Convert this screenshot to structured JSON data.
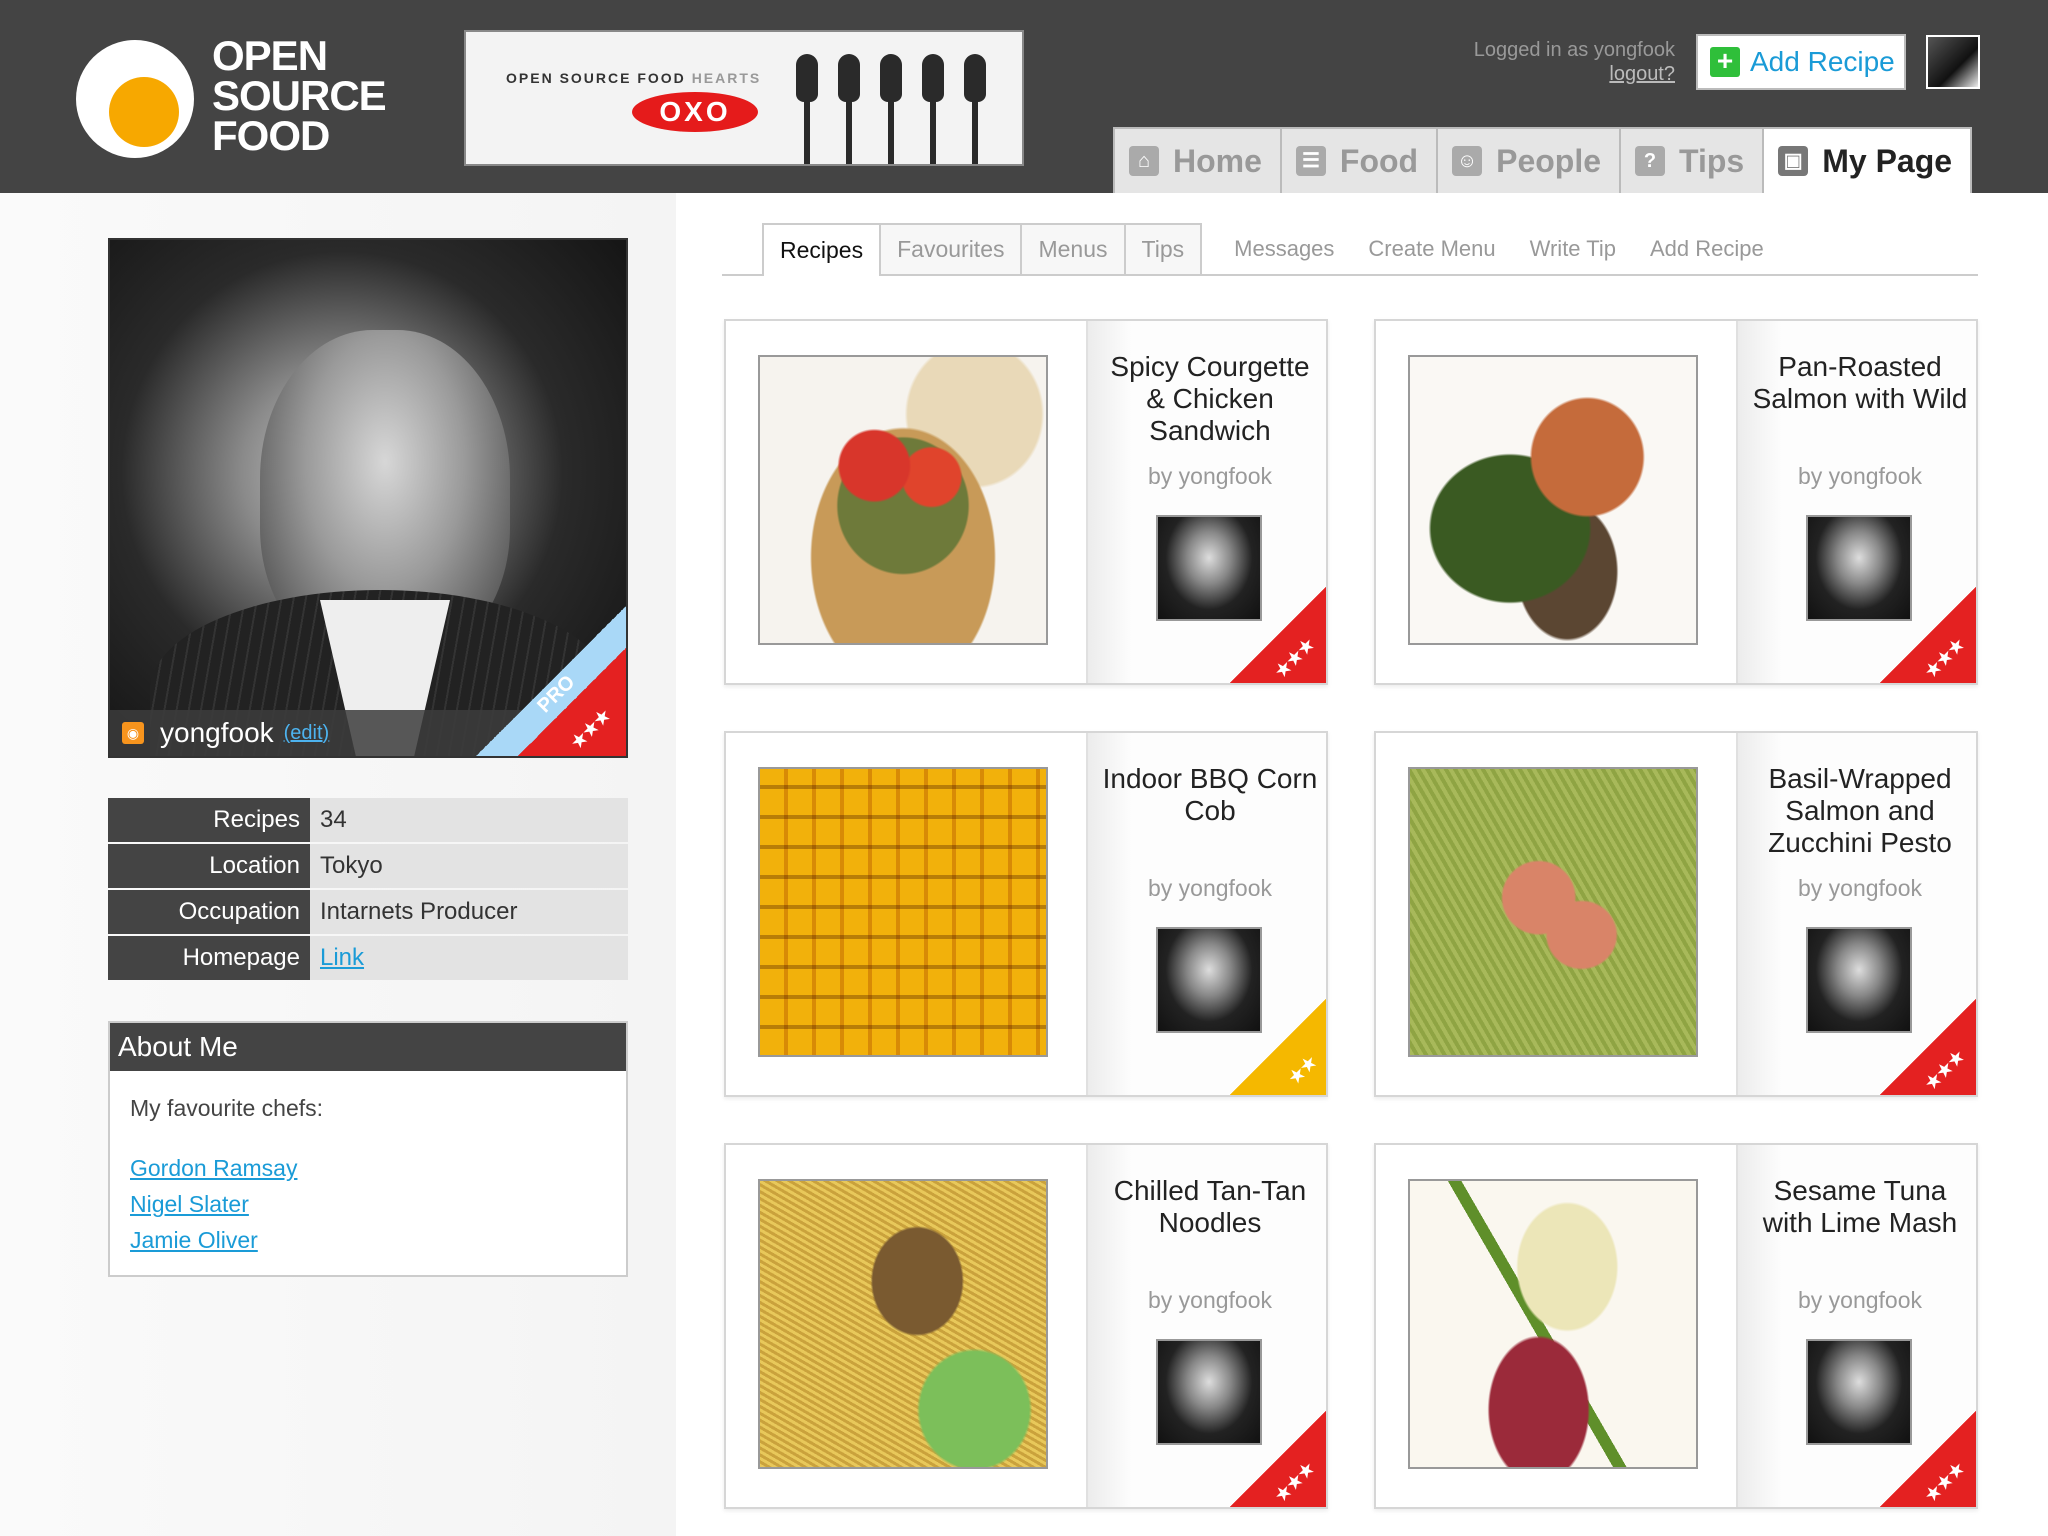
{
  "logo": {
    "line1": "OPEN",
    "line2": "SOURCE",
    "line3": "FOOD"
  },
  "banner": {
    "text": "OPEN SOURCE FOOD",
    "hearts": "HEARTS",
    "brand": "OXO"
  },
  "user_status": {
    "logged_in_text": "Logged in as yongfook",
    "logout": "logout?"
  },
  "add_recipe_button": {
    "icon": "plus-icon",
    "label": "Add Recipe"
  },
  "main_nav": [
    {
      "label": "Home",
      "icon": "home-icon",
      "active": false
    },
    {
      "label": "Food",
      "icon": "food-icon",
      "active": false
    },
    {
      "label": "People",
      "icon": "people-icon",
      "active": false
    },
    {
      "label": "Tips",
      "icon": "tips-icon",
      "active": false
    },
    {
      "label": "My Page",
      "icon": "user-icon",
      "active": true
    }
  ],
  "profile": {
    "username": "yongfook",
    "edit_link": "(edit)",
    "badge": "PRO",
    "badge_stars": "★★★"
  },
  "stats": [
    {
      "label": "Recipes",
      "value": "34",
      "is_link": false
    },
    {
      "label": "Location",
      "value": "Tokyo",
      "is_link": false
    },
    {
      "label": "Occupation",
      "value": "Intarnets Producer",
      "is_link": false
    },
    {
      "label": "Homepage",
      "value": "Link",
      "is_link": true
    }
  ],
  "about": {
    "title": "About Me",
    "intro": "My favourite chefs:",
    "chefs": [
      "Gordon Ramsay",
      "Nigel Slater",
      "Jamie Oliver"
    ]
  },
  "sub_tabs": [
    {
      "label": "Recipes",
      "active": true
    },
    {
      "label": "Favourites",
      "active": false
    },
    {
      "label": "Menus",
      "active": false
    },
    {
      "label": "Tips",
      "active": false
    }
  ],
  "sub_links": [
    "Messages",
    "Create Menu",
    "Write Tip",
    "Add Recipe"
  ],
  "recipes": [
    {
      "title": "Spicy Courgette & Chicken Sandwich",
      "by": "by yongfook",
      "rating_color": "#e42121",
      "stars": "★★★"
    },
    {
      "title": "Pan-Roasted Salmon with Wild",
      "by": "by yongfook",
      "rating_color": "#e42121",
      "stars": "★★★"
    },
    {
      "title": "Indoor BBQ Corn Cob",
      "by": "by yongfook",
      "rating_color": "#f5b800",
      "stars": "★★"
    },
    {
      "title": "Basil-Wrapped Salmon and Zucchini Pesto",
      "by": "by yongfook",
      "rating_color": "#e42121",
      "stars": "★★★"
    },
    {
      "title": "Chilled Tan-Tan Noodles",
      "by": "by yongfook",
      "rating_color": "#e42121",
      "stars": "★★★"
    },
    {
      "title": "Sesame Tuna with Lime Mash",
      "by": "by yongfook",
      "rating_color": "#e42121",
      "stars": "★★★"
    }
  ]
}
